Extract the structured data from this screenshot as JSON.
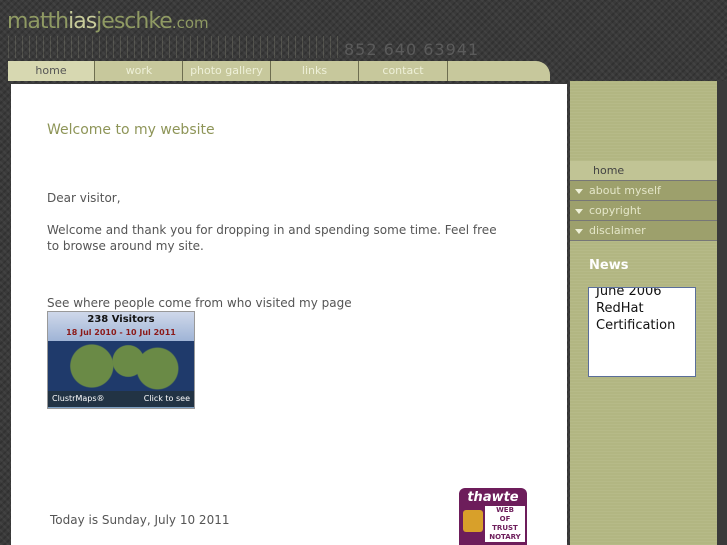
{
  "logo": {
    "part1": "matth",
    "part2": "ias",
    "part3": "jeschke",
    "part4": ".com"
  },
  "phone": "852 640 63941",
  "nav": {
    "tabs": [
      {
        "label": "home"
      },
      {
        "label": "work"
      },
      {
        "label": "photo gallery"
      },
      {
        "label": "links"
      },
      {
        "label": "contact"
      }
    ]
  },
  "main": {
    "heading": "Welcome to my website",
    "greeting": "Dear visitor,",
    "intro": "Welcome and thank you for dropping in and spending some time. Feel free to browse around my site.",
    "map_caption": "See where people come from who visited my page",
    "clustrmap": {
      "visitors": "238 Visitors",
      "range": "18 Jul 2010 - 10 Jul 2011",
      "brand": "ClustrMaps®",
      "cta": "Click to see"
    },
    "thawte": {
      "brand": "thawte",
      "line1": "WEB",
      "line2": "OF",
      "line3": "TRUST",
      "line4": "NOTARY"
    },
    "today": "Today is Sunday, July 10 2011"
  },
  "sidebar": {
    "items": [
      {
        "label": "home"
      },
      {
        "label": "about myself"
      },
      {
        "label": "copyright"
      },
      {
        "label": "disclaimer"
      }
    ],
    "news_title": "News",
    "news": {
      "line1": "June 2006",
      "line2": "RedHat",
      "line3": "Certification"
    }
  },
  "colors": {
    "olive": "#8e9558",
    "nav": "#c7c89c",
    "sidebar": "#b2b682",
    "thawte": "#6d1d5b"
  }
}
